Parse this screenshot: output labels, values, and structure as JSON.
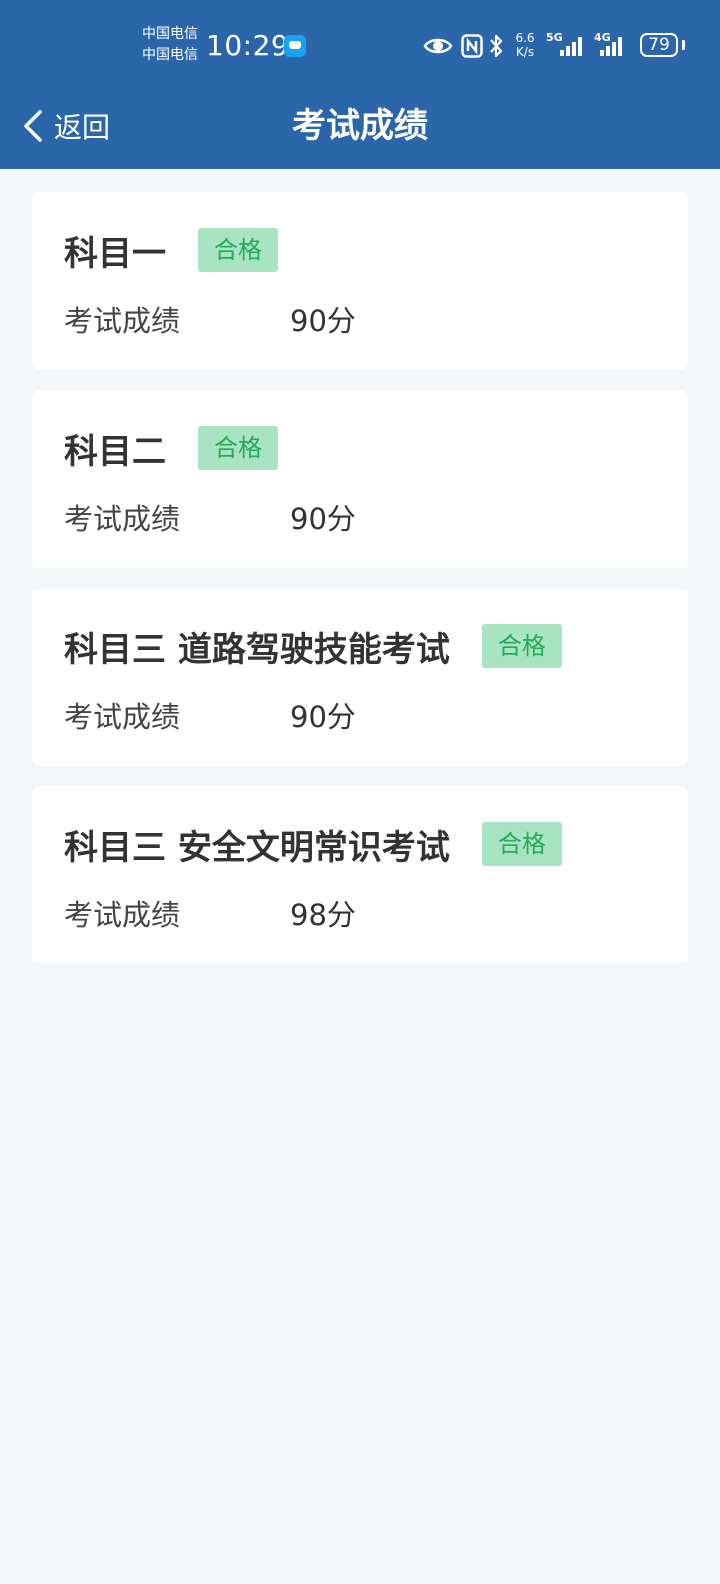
{
  "status_bar": {
    "carrier_1": "中国电信",
    "carrier_2": "中国电信",
    "time": "10:29",
    "speed_value": "6.6",
    "speed_unit": "K/s",
    "network_1": "5G",
    "network_2": "4G",
    "battery": "79",
    "icons": [
      "message-icon",
      "eye-icon",
      "nfc-icon",
      "bluetooth-icon",
      "signal-5g-icon",
      "signal-4g-icon",
      "battery-icon"
    ]
  },
  "nav": {
    "back_label": "返回",
    "title": "考试成绩"
  },
  "colors": {
    "header_bg": "#2c66aa",
    "page_bg": "#f4f7f9",
    "badge_bg": "#a9e4c2",
    "badge_text": "#27a95a"
  },
  "results": [
    {
      "subject": "科目一",
      "status": "合格",
      "score_label": "考试成绩",
      "score": "90分"
    },
    {
      "subject": "科目二",
      "status": "合格",
      "score_label": "考试成绩",
      "score": "90分"
    },
    {
      "subject": "科目三 道路驾驶技能考试",
      "status": "合格",
      "score_label": "考试成绩",
      "score": "90分"
    },
    {
      "subject": "科目三 安全文明常识考试",
      "status": "合格",
      "score_label": "考试成绩",
      "score": "98分"
    }
  ]
}
